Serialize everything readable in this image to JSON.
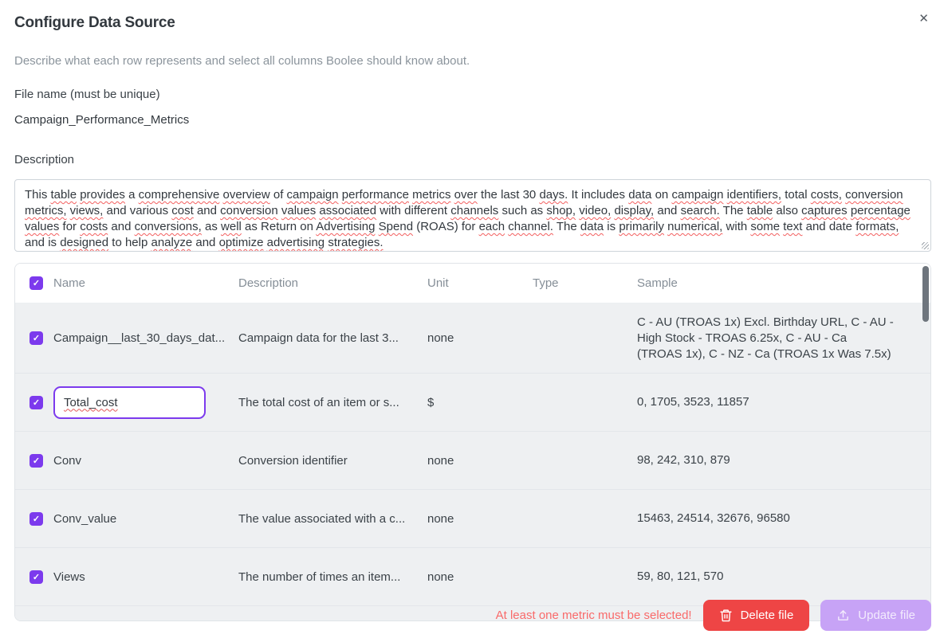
{
  "dialog": {
    "title": "Configure Data Source",
    "subtitle": "Describe what each row represents and select all columns Boolee should know about.",
    "close_glyph": "✕"
  },
  "file_name": {
    "label": "File name (must be unique)",
    "value": "Campaign_Performance_Metrics"
  },
  "description": {
    "label": "Description",
    "value": "This table provides a comprehensive overview of campaign performance metrics over the last 30 days. It includes data on campaign identifiers, total costs, conversion metrics, views, and various cost and conversion values associated with different channels such as shop, video, display, and search. The table also captures percentage values for costs and conversions, as well as Return on Advertising Spend (ROAS) for each channel. The data is primarily numerical, with some text and date formats, and is designed to help analyze and optimize advertising strategies.",
    "flagged_words": [
      "table",
      "provides",
      "comprehensive",
      "overview",
      "campaign",
      "performance",
      "metrics",
      "over",
      "days",
      "identifiers",
      "costs",
      "conversion",
      "views",
      "cost",
      "values",
      "associated",
      "channels",
      "shop",
      "video",
      "display",
      "search",
      "captures",
      "percentage",
      "conversions",
      "well",
      "spend",
      "each",
      "channel",
      "data",
      "primarily",
      "numerical",
      "some",
      "text",
      "formats",
      "designed",
      "analyze",
      "optimize",
      "advertising",
      "strategies"
    ]
  },
  "table": {
    "select_all_checked": true,
    "columns": {
      "name": "Name",
      "description": "Description",
      "unit": "Unit",
      "type": "Type",
      "sample": "Sample"
    },
    "rows": [
      {
        "checked": true,
        "editing": false,
        "name": "Campaign__last_30_days_dat...",
        "description": "Campaign data for the last 3...",
        "unit": "none",
        "type": "",
        "sample": "C - AU (TROAS 1x) Excl. Birthday URL, C - AU - High Stock - TROAS 6.25x, C - AU - Ca (TROAS 1x), C - NZ - Ca (TROAS 1x Was 7.5x)"
      },
      {
        "checked": true,
        "editing": true,
        "name": "Total_cost",
        "description": "The total cost of an item or s...",
        "unit": "$",
        "type": "",
        "sample": "0, 1705, 3523, 11857"
      },
      {
        "checked": true,
        "editing": false,
        "name": "Conv",
        "description": "Conversion identifier",
        "unit": "none",
        "type": "",
        "sample": "98, 242, 310, 879"
      },
      {
        "checked": true,
        "editing": false,
        "name": "Conv_value",
        "description": "The value associated with a c...",
        "unit": "none",
        "type": "",
        "sample": "15463, 24514, 32676, 96580"
      },
      {
        "checked": true,
        "editing": false,
        "name": "Views",
        "description": "The number of times an item...",
        "unit": "none",
        "type": "",
        "sample": "59, 80, 121, 570"
      }
    ]
  },
  "footer": {
    "warning": "At least one metric must be selected!",
    "delete_label": "Delete file",
    "update_label": "Update file"
  },
  "colors": {
    "accent": "#7c3aed",
    "danger": "#ee4545",
    "update_disabled": "#c7a3f6",
    "warning_text": "#f96a6a",
    "row_bg": "#eef0f2"
  }
}
